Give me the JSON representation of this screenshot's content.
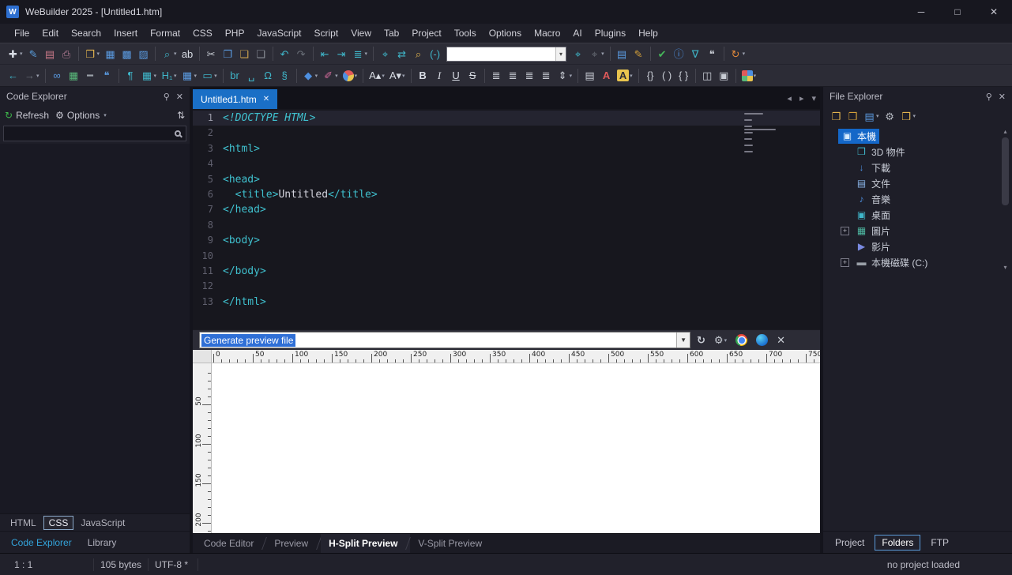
{
  "window": {
    "title": "WeBuilder 2025 - [Untitled1.htm]",
    "app_initial": "W"
  },
  "menu": {
    "items": [
      "File",
      "Edit",
      "Search",
      "Insert",
      "Format",
      "CSS",
      "PHP",
      "JavaScript",
      "Script",
      "View",
      "Tab",
      "Project",
      "Tools",
      "Options",
      "Macro",
      "AI",
      "Plugins",
      "Help"
    ]
  },
  "toolbar_main": [
    {
      "n": "new-file",
      "g": "✚",
      "c": "#d8dce4",
      "dd": true
    },
    {
      "n": "new-from-template",
      "g": "✎",
      "c": "#5aa0e0"
    },
    {
      "n": "reopen-file",
      "g": "▤",
      "c": "#c87888"
    },
    {
      "n": "print",
      "g": "⎙",
      "c": "#b88098"
    },
    {
      "sep": true
    },
    {
      "n": "open-file",
      "g": "❒",
      "c": "#e2b44e",
      "dd": true
    },
    {
      "n": "save-file",
      "g": "▦",
      "c": "#5a9ae0"
    },
    {
      "n": "save-all",
      "g": "▩",
      "c": "#5a9ae0"
    },
    {
      "n": "save-as",
      "g": "▨",
      "c": "#5a9ae0"
    },
    {
      "sep": true
    },
    {
      "n": "quick-search",
      "g": "⌕",
      "c": "#3fb6c9",
      "dd": true
    },
    {
      "n": "spell-check",
      "g": "ab",
      "c": "#d8dce4"
    },
    {
      "sep": true
    },
    {
      "n": "cut",
      "g": "✂",
      "c": "#c8ccd4"
    },
    {
      "n": "copy",
      "g": "❐",
      "c": "#5a9ae0"
    },
    {
      "n": "paste",
      "g": "❏",
      "c": "#c8a04e"
    },
    {
      "n": "paste-special",
      "g": "❏",
      "c": "#8a8f98"
    },
    {
      "sep": true
    },
    {
      "n": "undo",
      "g": "↶",
      "c": "#3fb6c9"
    },
    {
      "n": "redo",
      "g": "↷",
      "c": "#6a6f78"
    },
    {
      "sep": true
    },
    {
      "n": "unindent",
      "g": "⇤",
      "c": "#3fb6c9"
    },
    {
      "n": "indent",
      "g": "⇥",
      "c": "#3fb6c9"
    },
    {
      "n": "line-tools",
      "g": "≣",
      "c": "#3fb6c9",
      "dd": true
    },
    {
      "sep": true
    },
    {
      "n": "find",
      "g": "⌖",
      "c": "#3fb6c9"
    },
    {
      "n": "replace",
      "g": "⇄",
      "c": "#3fb6c9"
    },
    {
      "n": "find-in-files",
      "g": "⌕",
      "c": "#e2b44e"
    },
    {
      "n": "surround-with",
      "g": "(-)",
      "c": "#3fb6c9"
    },
    {
      "input": true,
      "n": "toolbar-search"
    },
    {
      "n": "find-next",
      "g": "⌖",
      "c": "#3fb6c9"
    },
    {
      "n": "find-previous",
      "g": "⌖",
      "c": "#6a6f78",
      "dd": true
    },
    {
      "sep": true
    },
    {
      "n": "document-map",
      "g": "▤",
      "c": "#5a9ae0"
    },
    {
      "n": "edit-highlight",
      "g": "✎",
      "c": "#d4a03a"
    },
    {
      "sep": true
    },
    {
      "n": "validate",
      "g": "✔",
      "c": "#46b85a"
    },
    {
      "n": "document-info",
      "g": "ⓘ",
      "c": "#4d8fe0"
    },
    {
      "n": "filter",
      "g": "∇",
      "c": "#3fb6c9"
    },
    {
      "n": "comments",
      "g": "❝",
      "c": "#c8ccd4"
    },
    {
      "sep": true
    },
    {
      "n": "refresh-browser",
      "g": "↻",
      "c": "#e0883a",
      "dd": true
    }
  ],
  "toolbar_format": [
    {
      "n": "navigate-back",
      "g": "←",
      "c": "#3fb6c9"
    },
    {
      "n": "navigate-forward",
      "g": "→",
      "c": "#6a6f78",
      "dd": true
    },
    {
      "sep": true
    },
    {
      "n": "hyperlink",
      "g": "∞",
      "c": "#5a9ae0"
    },
    {
      "n": "insert-image",
      "g": "▦",
      "c": "#58b87a"
    },
    {
      "n": "horizontal-rule",
      "g": "━",
      "c": "#9aa0a8"
    },
    {
      "n": "insert-comment",
      "g": "❝",
      "c": "#5a9ae0"
    },
    {
      "sep": true
    },
    {
      "n": "paragraph",
      "g": "¶",
      "c": "#3fb6c9"
    },
    {
      "n": "insert-table",
      "g": "▦",
      "c": "#3fb6c9",
      "dd": true
    },
    {
      "n": "heading",
      "g": "H₁",
      "c": "#3fb6c9",
      "dd": true
    },
    {
      "n": "table-wizard",
      "g": "▦",
      "c": "#5a9ae0",
      "dd": true
    },
    {
      "n": "insert-form",
      "g": "▭",
      "c": "#3fb6c9",
      "dd": true
    },
    {
      "sep": true
    },
    {
      "n": "line-break",
      "g": "br",
      "c": "#3fb6c9"
    },
    {
      "n": "non-breaking-space",
      "g": "␣",
      "c": "#3fb6c9"
    },
    {
      "n": "omega-entities",
      "g": "Ω",
      "c": "#3fb6c9"
    },
    {
      "n": "special-characters",
      "g": "§",
      "c": "#3fb6c9"
    },
    {
      "sep": true
    },
    {
      "n": "css-style",
      "g": "◆",
      "c": "#4d8fe0",
      "dd": true
    },
    {
      "n": "format-painter",
      "g": "✐",
      "c": "#d06a9a",
      "dd": true
    },
    {
      "n": "color-picker",
      "shape": "colorwheel",
      "dd": true
    },
    {
      "sep": true
    },
    {
      "n": "increase-font",
      "g": "A▴",
      "c": "#d8dce4",
      "dd": true
    },
    {
      "n": "decrease-font",
      "g": "A▾",
      "c": "#d8dce4",
      "dd": true
    },
    {
      "sep": true
    },
    {
      "n": "bold",
      "g": "B",
      "c": "#d8dce4",
      "cls": "fw"
    },
    {
      "n": "italic",
      "g": "I",
      "c": "#d8dce4",
      "cls": "it"
    },
    {
      "n": "underline",
      "g": "U",
      "c": "#d8dce4",
      "cls": "un"
    },
    {
      "n": "strikethrough",
      "g": "S",
      "c": "#d8dce4",
      "cls": "st"
    },
    {
      "sep": true
    },
    {
      "n": "align-left",
      "g": "≣",
      "c": "#c8ccd4"
    },
    {
      "n": "align-center",
      "g": "≣",
      "c": "#c8ccd4"
    },
    {
      "n": "align-right",
      "g": "≣",
      "c": "#c8ccd4"
    },
    {
      "n": "align-justify",
      "g": "≣",
      "c": "#c8ccd4"
    },
    {
      "n": "line-spacing",
      "g": "⇕",
      "c": "#c8ccd4",
      "dd": true
    },
    {
      "sep": true
    },
    {
      "n": "page-properties",
      "g": "▤",
      "c": "#c8ccd4"
    },
    {
      "n": "font-color",
      "g": "A",
      "c": "#e05a5a",
      "cls": "fw"
    },
    {
      "n": "highlight-color",
      "g": "A",
      "c": "#2b2b35",
      "cls": "hl",
      "dd": true
    },
    {
      "sep": true
    },
    {
      "n": "match-braces",
      "g": "{}",
      "c": "#c8ccd4"
    },
    {
      "n": "match-parentheses",
      "g": "( )",
      "c": "#c8ccd4"
    },
    {
      "n": "code-blocks",
      "g": "{ }",
      "c": "#c8ccd4"
    },
    {
      "sep": true
    },
    {
      "n": "split-editor",
      "g": "◫",
      "c": "#c8ccd4"
    },
    {
      "n": "full-screen",
      "g": "▣",
      "c": "#c8ccd4"
    },
    {
      "sep": true
    },
    {
      "n": "color-palette",
      "shape": "palette",
      "dd": true
    }
  ],
  "left_panel": {
    "title": "Code Explorer",
    "refresh_label": "Refresh",
    "options_label": "Options",
    "search_value": "",
    "lang_tabs": [
      {
        "label": "HTML"
      },
      {
        "label": "CSS",
        "active": true
      },
      {
        "label": "JavaScript"
      }
    ],
    "bottom_tabs": [
      {
        "label": "Code Explorer",
        "active": true
      },
      {
        "label": "Library"
      }
    ]
  },
  "editor": {
    "tab_label": "Untitled1.htm",
    "active_line": 1,
    "lines": [
      [
        {
          "t": "<!DOCTYPE HTML>",
          "c": "doctype"
        }
      ],
      [],
      [
        {
          "t": "<html>",
          "c": "tag"
        }
      ],
      [],
      [
        {
          "t": "<head>",
          "c": "tag"
        }
      ],
      [
        {
          "t": "  ",
          "c": "plain"
        },
        {
          "t": "<title>",
          "c": "tag"
        },
        {
          "t": "Untitled",
          "c": "plain"
        },
        {
          "t": "</title>",
          "c": "tag"
        }
      ],
      [
        {
          "t": "</head>",
          "c": "tag"
        }
      ],
      [],
      [
        {
          "t": "<body>",
          "c": "tag"
        }
      ],
      [],
      [
        {
          "t": "</body>",
          "c": "tag"
        }
      ],
      [],
      [
        {
          "t": "</html>",
          "c": "tag"
        }
      ]
    ],
    "bottom_tabs": [
      {
        "label": "Code Editor"
      },
      {
        "label": "Preview"
      },
      {
        "label": "H-Split Preview",
        "active": true
      },
      {
        "label": "V-Split Preview"
      }
    ]
  },
  "preview": {
    "combo_value": "Generate preview file",
    "h_ruler_max": 750,
    "v_ruler_max": 210,
    "ruler_step": 50
  },
  "right_panel": {
    "title": "File Explorer",
    "tools": [
      {
        "n": "browse-folder",
        "g": "❒",
        "c": "#e2b44e"
      },
      {
        "n": "favorites-folder",
        "g": "❒",
        "c": "#d4a03a"
      },
      {
        "n": "view-mode",
        "g": "▤",
        "c": "#5a9ae0",
        "dd": true
      },
      {
        "n": "folder-settings",
        "g": "⚙",
        "c": "#b8bcc4"
      },
      {
        "n": "recent-folders",
        "g": "❒",
        "c": "#e2b44e",
        "dd": true
      }
    ],
    "tree": [
      {
        "label": "本機",
        "icon": "computer",
        "glyph": "▣",
        "color": "#3fb6c9",
        "level": 0,
        "selected": true
      },
      {
        "label": "3D 物件",
        "icon": "objects-3d",
        "glyph": "❒",
        "color": "#3fb6c9",
        "level": 1
      },
      {
        "label": "下載",
        "icon": "download",
        "glyph": "↓",
        "color": "#4d8fe0",
        "level": 1
      },
      {
        "label": "文件",
        "icon": "documents",
        "glyph": "▤",
        "color": "#8ab4e8",
        "level": 1
      },
      {
        "label": "音樂",
        "icon": "music",
        "glyph": "♪",
        "color": "#4d8fe0",
        "level": 1
      },
      {
        "label": "桌面",
        "icon": "desktop",
        "glyph": "▣",
        "color": "#3fb6c9",
        "level": 1
      },
      {
        "label": "圖片",
        "icon": "pictures",
        "glyph": "▦",
        "color": "#4db6a0",
        "level": 1,
        "expandable": true
      },
      {
        "label": "影片",
        "icon": "videos",
        "glyph": "▶",
        "color": "#7a8ae0",
        "level": 1
      },
      {
        "label": "本機磁碟 (C:)",
        "icon": "drive",
        "glyph": "▬",
        "color": "#9aa0a8",
        "level": 1,
        "expandable": true
      }
    ],
    "bottom_tabs": [
      {
        "label": "Project"
      },
      {
        "label": "Folders",
        "active": true
      },
      {
        "label": "FTP"
      }
    ]
  },
  "status": {
    "caret": "1 : 1",
    "size": "105 bytes",
    "encoding": "UTF-8 *",
    "project": "no project loaded"
  },
  "colors": {
    "accent": "#1a6fc6",
    "selection": "#1565c0",
    "syntax_tag": "#3fc0ce"
  }
}
